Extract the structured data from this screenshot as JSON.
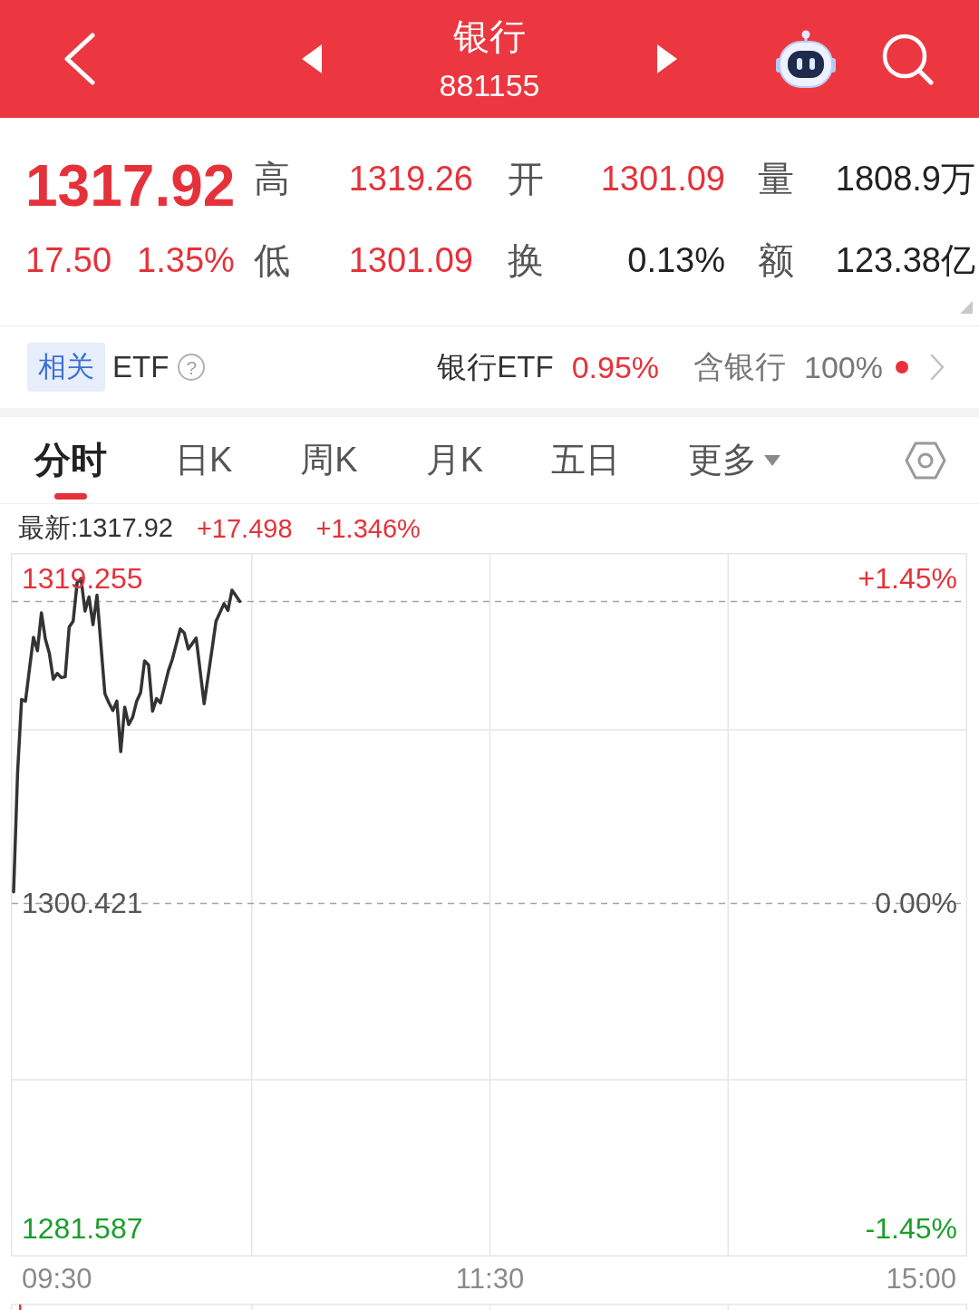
{
  "header": {
    "title": "银行",
    "code": "881155"
  },
  "quote": {
    "price": "1317.92",
    "change": "17.50",
    "change_percent": "1.35%",
    "color": "#e5323a",
    "stats": [
      {
        "label": "高",
        "value": "1319.26",
        "color": "#e5323a"
      },
      {
        "label": "开",
        "value": "1301.09",
        "color": "#e5323a"
      },
      {
        "label": "量",
        "value": "1808.9万",
        "color": "#222222"
      },
      {
        "label": "低",
        "value": "1301.09",
        "color": "#e5323a"
      },
      {
        "label": "换",
        "value": "0.13%",
        "color": "#222222"
      },
      {
        "label": "额",
        "value": "123.38亿",
        "color": "#222222"
      }
    ]
  },
  "etf": {
    "tag": "相关",
    "label": "ETF",
    "help_symbol": "?",
    "fund": {
      "name": "银行ETF",
      "change": "0.95%",
      "color": "#e5323a"
    },
    "holding_label": "含银行",
    "holding_value": "100%",
    "notification": true
  },
  "tabs": [
    {
      "label": "分时",
      "selected": true,
      "kind": "plain"
    },
    {
      "label": "日K",
      "selected": false,
      "kind": "plain"
    },
    {
      "label": "周K",
      "selected": false,
      "kind": "plain"
    },
    {
      "label": "月K",
      "selected": false,
      "kind": "plain"
    },
    {
      "label": "五日",
      "selected": false,
      "kind": "plain"
    },
    {
      "label": "更多",
      "selected": false,
      "kind": "dropdown"
    }
  ],
  "chart": {
    "latest": {
      "label": "最新:1317.92",
      "change": "+17.498",
      "change_percent": "+1.346%",
      "color": "#e5323a"
    },
    "percent_labels": [
      {
        "text": "+1.45%",
        "color": "#e5323a"
      },
      {
        "text": "0.00%",
        "color": "#555555"
      },
      {
        "text": "-1.45%",
        "color": "#1a9e2c"
      }
    ],
    "time_labels": [
      "09:30",
      "11:30",
      "15:00"
    ],
    "chart_data": {
      "type": "line",
      "categories": [
        null,
        null,
        null,
        null,
        null,
        null,
        null,
        null,
        null,
        null,
        null,
        null,
        null,
        null,
        null,
        null,
        null,
        null,
        null,
        null,
        null,
        null,
        null,
        null,
        null,
        null,
        null,
        null,
        null,
        null,
        null,
        null,
        null,
        null,
        null,
        null,
        null,
        null,
        null,
        null,
        null,
        null,
        null,
        null,
        null,
        null,
        null,
        null,
        null,
        null,
        null,
        null,
        null,
        null,
        null,
        null,
        null,
        null,
        null,
        null,
        null,
        null,
        null,
        null,
        null,
        null,
        null,
        null,
        null,
        null,
        null,
        null,
        null,
        null,
        null,
        null,
        null,
        null,
        null,
        null,
        null,
        null,
        null,
        null,
        null,
        null,
        null,
        null,
        null,
        null,
        null,
        null,
        null,
        null,
        null,
        null,
        null,
        null,
        null,
        null,
        null,
        null,
        null,
        null,
        null,
        null,
        null,
        null,
        null,
        null,
        null,
        null,
        null,
        null,
        null,
        null,
        null,
        null,
        null,
        null,
        null,
        null,
        null,
        null,
        null,
        null,
        null,
        null,
        null,
        null,
        null,
        null,
        null,
        null,
        null,
        null,
        null,
        null,
        null,
        null,
        null,
        null,
        null,
        null,
        null,
        null,
        null,
        null,
        null,
        null,
        null,
        null,
        null,
        null,
        null,
        null,
        null,
        null,
        null,
        null,
        null,
        null,
        null,
        null,
        null,
        null,
        null,
        null,
        null,
        null,
        null,
        null,
        null,
        null,
        null,
        null,
        null,
        null,
        null,
        null,
        null,
        null,
        null,
        null,
        null,
        null,
        null,
        null,
        null,
        null,
        null,
        null,
        null,
        null,
        null,
        null,
        null,
        null,
        null,
        null,
        null,
        null,
        null,
        null,
        null,
        null,
        null,
        null,
        null,
        null,
        null,
        null,
        null,
        null,
        null,
        null,
        null,
        null,
        null,
        null,
        null,
        null,
        null,
        null,
        null,
        null,
        null,
        null,
        null,
        null,
        null,
        null,
        null,
        null,
        null,
        null,
        null,
        null,
        null,
        null,
        null
      ],
      "ylim": [
        1279.958,
        1320.726
      ],
      "yticks": [
        {
          "value": 1319.255,
          "label": "1319.255"
        },
        {
          "value": 1300.421,
          "label": "1300.421"
        },
        {
          "value": 1281.587,
          "label": "1281.587"
        }
      ],
      "series": [
        {
          "color": "#333333",
          "values": [
            1301.09,
            1308.0,
            1312.24,
            1312.14,
            1314.0,
            1315.84,
            1315.06,
            1317.26,
            1315.75,
            1314.92,
            1313.41,
            1313.75,
            1313.51,
            1313.55,
            1316.43,
            1316.77,
            1319.01,
            1319.25,
            1317.36,
            1318.18,
            1316.58,
            1318.28,
            1315.41,
            1312.58,
            1312.04,
            1311.6,
            1312.14,
            1309.22,
            1311.8,
            1310.78,
            1311.22,
            1312.14,
            1312.63,
            1314.48,
            1314.24,
            1311.56,
            1312.29,
            1312.04,
            1312.97,
            1313.9,
            1314.58,
            1315.45,
            1316.33,
            1316.09,
            1315.16,
            1315.48,
            1315.8,
            1313.9,
            1311.99,
            1313.58,
            1315.18,
            1316.77,
            1317.28,
            1317.79,
            1317.4,
            1318.57,
            1318.25,
            1317.92,
            null,
            null,
            null,
            null,
            null,
            null,
            null,
            null,
            null,
            null,
            null,
            null,
            null,
            null,
            null,
            null,
            null,
            null,
            null,
            null,
            null,
            null,
            null,
            null,
            null,
            null,
            null,
            null,
            null,
            null,
            null,
            null,
            null,
            null,
            null,
            null,
            null,
            null,
            null,
            null,
            null,
            null,
            null,
            null,
            null,
            null,
            null,
            null,
            null,
            null,
            null,
            null,
            null,
            null,
            null,
            null,
            null,
            null,
            null,
            null,
            null,
            null,
            null,
            null,
            null,
            null,
            null,
            null,
            null,
            null,
            null,
            null,
            null,
            null,
            null,
            null,
            null,
            null,
            null,
            null,
            null,
            null,
            null,
            null,
            null,
            null,
            null,
            null,
            null,
            null,
            null,
            null,
            null,
            null,
            null,
            null,
            null,
            null,
            null,
            null,
            null,
            null,
            null,
            null,
            null,
            null,
            null,
            null,
            null,
            null,
            null,
            null,
            null,
            null,
            null,
            null,
            null,
            null,
            null,
            null,
            null,
            null,
            null,
            null,
            null,
            null,
            null,
            null,
            null,
            null,
            null,
            null,
            null,
            null,
            null,
            null,
            null,
            null,
            null,
            null,
            null,
            null,
            null,
            null,
            null,
            null,
            null,
            null,
            null,
            null,
            null,
            null,
            null,
            null,
            null,
            null,
            null,
            null,
            null,
            null,
            null,
            null,
            null,
            null,
            null,
            null,
            null,
            null,
            null,
            null,
            null,
            null,
            null,
            null,
            null,
            null,
            null,
            null,
            null,
            null,
            null,
            null,
            null
          ]
        }
      ],
      "ref_lines": [
        {
          "axis": "y",
          "value": 1317.92
        },
        {
          "axis": "y",
          "value": 1300.421
        }
      ]
    }
  }
}
